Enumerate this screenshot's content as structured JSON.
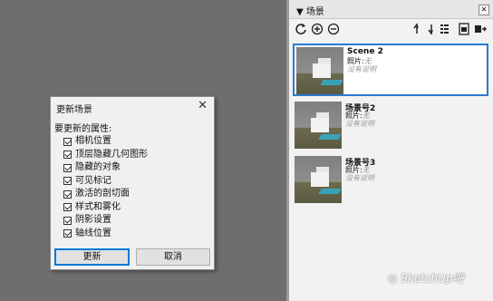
{
  "dialog": {
    "title": "更新场景",
    "close": "✕",
    "prompt": "要更新的属性:",
    "properties": [
      {
        "label": "相机位置",
        "checked": true
      },
      {
        "label": "顶层隐藏几何图形",
        "checked": true
      },
      {
        "label": "隐藏的对象",
        "checked": true
      },
      {
        "label": "可见标记",
        "checked": true
      },
      {
        "label": "激活的剖切面",
        "checked": true
      },
      {
        "label": "样式和雾化",
        "checked": true
      },
      {
        "label": "阴影设置",
        "checked": true
      },
      {
        "label": "轴线位置",
        "checked": true
      }
    ],
    "update_label": "更新",
    "cancel_label": "取消"
  },
  "panel": {
    "title": "▼ 场景",
    "close": "✕",
    "toolbar_icons": [
      "refresh-icon",
      "add-icon",
      "remove-icon",
      "move-up-icon",
      "move-down-icon",
      "view-options-icon",
      "thumbnail-icon",
      "details-icon"
    ],
    "scenes": [
      {
        "name": "Scene 2",
        "pic_label": "照片:",
        "pic_value": "无",
        "desc": "没有说明",
        "selected": true
      },
      {
        "name": "场景号2",
        "pic_label": "照片:",
        "pic_value": "无",
        "desc": "没有说明",
        "selected": false
      },
      {
        "name": "场景号3",
        "pic_label": "照片:",
        "pic_value": "无",
        "desc": "没有说明",
        "selected": false
      }
    ]
  },
  "watermark": "SketchUp吧"
}
